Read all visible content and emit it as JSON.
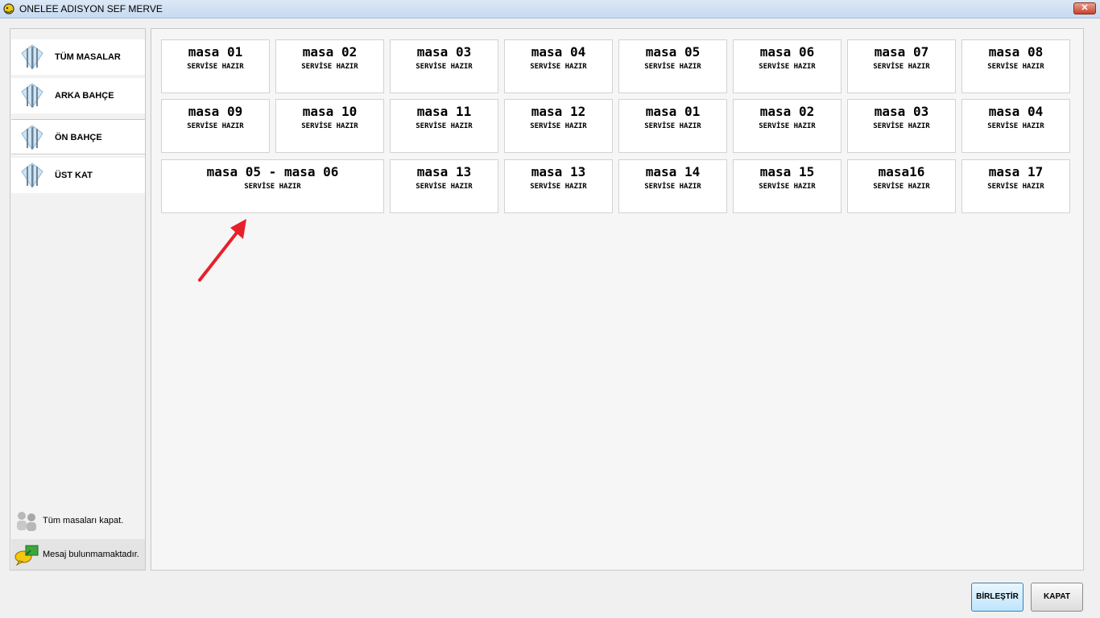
{
  "window": {
    "title": "ONELEE ADISYON SEF MERVE",
    "close_glyph": "✕"
  },
  "sidebar": {
    "items": [
      {
        "label": "TÜM MASALAR",
        "icon": "cutlery-icon"
      },
      {
        "label": "ARKA BAHÇE",
        "icon": "cutlery-icon"
      },
      {
        "label": "ÖN BAHÇE",
        "icon": "cutlery-icon"
      },
      {
        "label": "ÜST KAT",
        "icon": "cutlery-icon"
      }
    ],
    "close_all_label": "Tüm masaları kapat.",
    "message_label": "Mesaj bulunmamaktadır."
  },
  "tables": [
    {
      "name": "masa 01",
      "status": "SERVİSE HAZIR"
    },
    {
      "name": "masa 02",
      "status": "SERVİSE HAZIR"
    },
    {
      "name": "masa 03",
      "status": "SERVİSE HAZIR"
    },
    {
      "name": "masa 04",
      "status": "SERVİSE HAZIR"
    },
    {
      "name": "masa 05",
      "status": "SERVİSE HAZIR"
    },
    {
      "name": "masa 06",
      "status": "SERVİSE HAZIR"
    },
    {
      "name": "masa 07",
      "status": "SERVİSE HAZIR"
    },
    {
      "name": "masa 08",
      "status": "SERVİSE HAZIR"
    },
    {
      "name": "masa 09",
      "status": "SERVİSE HAZIR"
    },
    {
      "name": "masa 10",
      "status": "SERVİSE HAZIR"
    },
    {
      "name": "masa 11",
      "status": "SERVİSE HAZIR"
    },
    {
      "name": "masa 12",
      "status": "SERVİSE HAZIR"
    },
    {
      "name": "masa 01",
      "status": "SERVİSE HAZIR"
    },
    {
      "name": "masa 02",
      "status": "SERVİSE HAZIR"
    },
    {
      "name": "masa 03",
      "status": "SERVİSE HAZIR"
    },
    {
      "name": "masa 04",
      "status": "SERVİSE HAZIR"
    },
    {
      "name": "masa 05 - masa 06",
      "status": "SERVİSE HAZIR"
    },
    {
      "name": "masa 13",
      "status": "SERVİSE HAZIR"
    },
    {
      "name": "masa 13",
      "status": "SERVİSE HAZIR"
    },
    {
      "name": "masa 14",
      "status": "SERVİSE HAZIR"
    },
    {
      "name": "masa 15",
      "status": "SERVİSE HAZIR"
    },
    {
      "name": "masa16",
      "status": "SERVİSE HAZIR"
    },
    {
      "name": "masa 17",
      "status": "SERVİSE HAZIR"
    }
  ],
  "buttons": {
    "merge": "BİRLEŞTİR",
    "close": "KAPAT"
  },
  "colors": {
    "arrow": "#e8202a",
    "merge_border": "#3c7fb1"
  }
}
